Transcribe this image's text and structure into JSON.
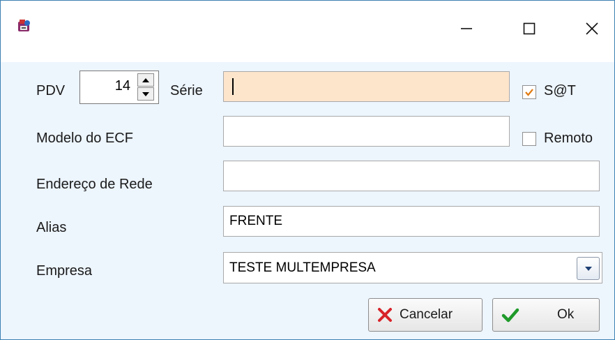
{
  "window": {
    "icon": "app-icon",
    "minimize_icon": "minimize-icon",
    "maximize_icon": "maximize-icon",
    "close_icon": "close-icon"
  },
  "form": {
    "pdv_label": "PDV",
    "pdv_value": "14",
    "serie_label": "Série",
    "serie_value": "",
    "sat_label": "S@T",
    "sat_checked": true,
    "modelo_label": "Modelo do ECF",
    "modelo_value": "",
    "remoto_label": "Remoto",
    "remoto_checked": false,
    "endereco_label": "Endereço de Rede",
    "endereco_value": "",
    "alias_label": "Alias",
    "alias_value": "FRENTE",
    "empresa_label": "Empresa",
    "empresa_value": "TESTE MULTEMPRESA"
  },
  "buttons": {
    "cancel_label": "Cancelar",
    "ok_label": "Ok"
  },
  "colors": {
    "client_bg": "#edf5fd",
    "focused_field_bg": "#fde5cc",
    "cancel_icon": "#d8232a",
    "ok_icon": "#1f9a2a",
    "checkmark": "#e07a10"
  }
}
